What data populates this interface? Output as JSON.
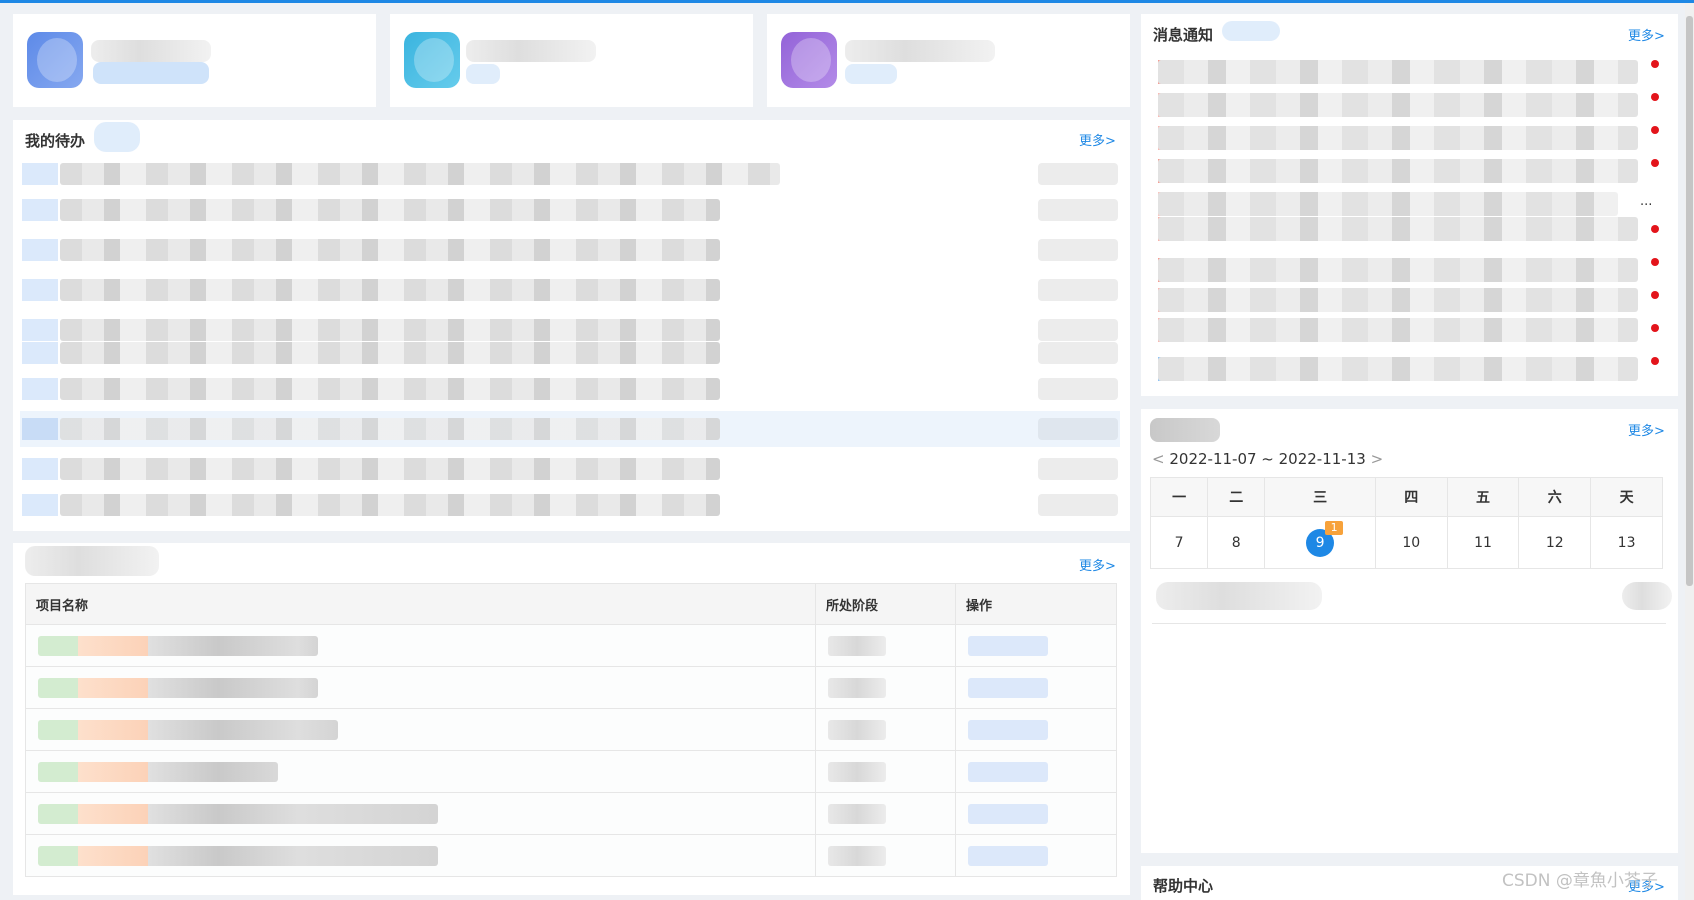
{
  "todo": {
    "title": "我的待办",
    "more": "更多>"
  },
  "projects": {
    "more": "更多>",
    "columns": [
      "项目名称",
      "所处阶段",
      "操作"
    ],
    "row_count_visible": 6
  },
  "notifications": {
    "title": "消息通知",
    "more": "更多>",
    "ellipsis": "..."
  },
  "calendar": {
    "more": "更多>",
    "range": "2022-11-07 ~ 2022-11-13",
    "prev": "<",
    "next": ">",
    "weekdays": [
      "一",
      "二",
      "三",
      "四",
      "五",
      "六",
      "天"
    ],
    "days": [
      "7",
      "8",
      "9",
      "10",
      "11",
      "12",
      "13"
    ],
    "today": "9",
    "today_badge": "1"
  },
  "help": {
    "title": "帮助中心",
    "more": "更多>"
  },
  "watermark": "CSDN @章魚小芥子",
  "colors": {
    "accent": "#1e88e5",
    "badge": "#f7a23b",
    "dot": "#e3141b"
  }
}
